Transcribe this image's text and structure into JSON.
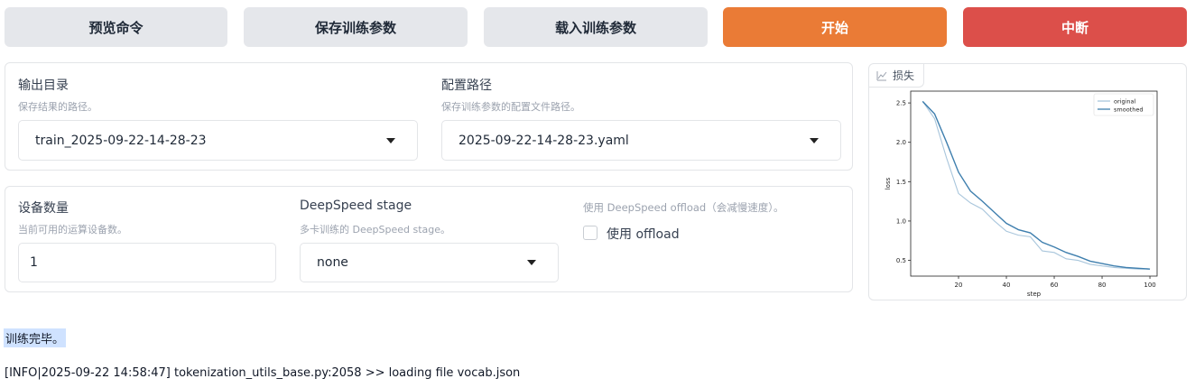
{
  "buttons": {
    "preview": "预览命令",
    "save": "保存训练参数",
    "load": "载入训练参数",
    "start": "开始",
    "abort": "中断"
  },
  "output_dir": {
    "label": "输出目录",
    "info": "保存结果的路径。",
    "value": "train_2025-09-22-14-28-23"
  },
  "config_path": {
    "label": "配置路径",
    "info": "保存训练参数的配置文件路径。",
    "value": "2025-09-22-14-28-23.yaml"
  },
  "device_count": {
    "label": "设备数量",
    "info": "当前可用的运算设备数。",
    "value": "1"
  },
  "ds_stage": {
    "label": "DeepSpeed stage",
    "info": "多卡训练的 DeepSpeed stage。",
    "value": "none"
  },
  "ds_offload": {
    "info": "使用 DeepSpeed offload（会减慢速度）。",
    "checkbox_label": "使用 offload",
    "checked": false
  },
  "loss_plot": {
    "tab_label": "损失",
    "icon": "chart-icon"
  },
  "output": {
    "status": "训练完毕。",
    "log_line": "[INFO|2025-09-22 14:58:47] tokenization_utils_base.py:2058 >> loading file vocab.json"
  },
  "chart_data": {
    "type": "line",
    "title": "",
    "xlabel": "step",
    "ylabel": "loss",
    "xlim": [
      0,
      103
    ],
    "ylim": [
      0.3,
      2.65
    ],
    "xticks": [
      20,
      40,
      60,
      80,
      100
    ],
    "yticks": [
      0.5,
      1.0,
      1.5,
      2.0,
      2.5
    ],
    "legend_position": "top-right",
    "series": [
      {
        "name": "original",
        "color": "#a9c6dc",
        "x": [
          5,
          10,
          15,
          20,
          25,
          30,
          35,
          40,
          45,
          50,
          55,
          60,
          65,
          70,
          75,
          80,
          85,
          90,
          95,
          100
        ],
        "y": [
          2.52,
          2.3,
          1.8,
          1.35,
          1.23,
          1.15,
          1.0,
          0.87,
          0.82,
          0.8,
          0.62,
          0.6,
          0.52,
          0.5,
          0.45,
          0.43,
          0.41,
          0.4,
          0.39,
          0.39
        ]
      },
      {
        "name": "smoothed",
        "color": "#3f7fae",
        "x": [
          5,
          10,
          15,
          20,
          25,
          30,
          35,
          40,
          45,
          50,
          55,
          60,
          65,
          70,
          75,
          80,
          85,
          90,
          95,
          100
        ],
        "y": [
          2.52,
          2.36,
          2.0,
          1.62,
          1.38,
          1.25,
          1.11,
          0.97,
          0.89,
          0.85,
          0.73,
          0.67,
          0.6,
          0.55,
          0.49,
          0.46,
          0.43,
          0.41,
          0.4,
          0.39
        ]
      }
    ]
  }
}
